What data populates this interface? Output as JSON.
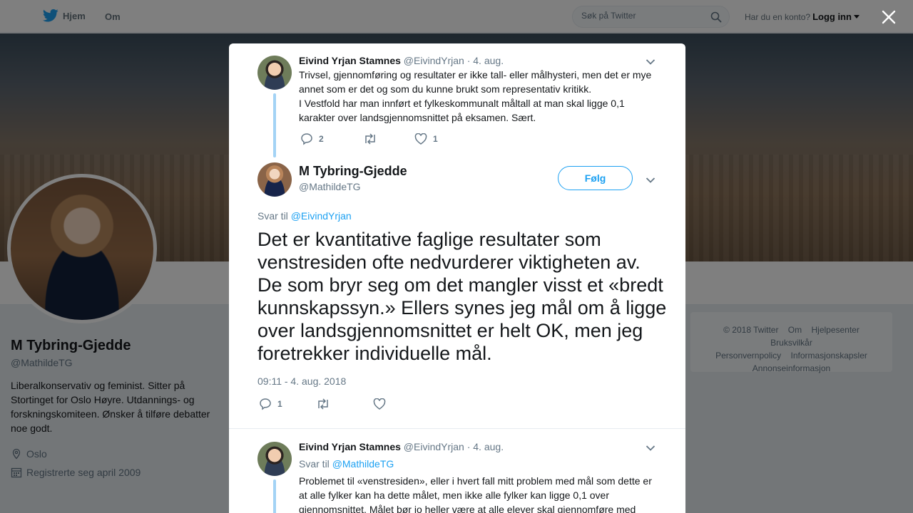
{
  "nav": {
    "home_label": "Hjem",
    "about_label": "Om",
    "search_placeholder": "Søk på Twitter",
    "account_prompt": "Har du en konto?",
    "login_label": "Logg inn"
  },
  "profile": {
    "name": "M Tybring-Gjedde",
    "handle": "@MathildeTG",
    "bio": "Liberalkonservativ og feminist. Sitter på Stortinget for Oslo Høyre. Utdannings- og forskningskomiteen. Ønsker å tilføre debatter noe godt.",
    "location": "Oslo",
    "joined": "Registrerte seg april 2009"
  },
  "footer": {
    "copyright": "© 2018 Twitter",
    "about": "Om",
    "help": "Hjelpesenter",
    "terms": "Bruksvilkår",
    "privacy": "Personvernpolicy",
    "cookies": "Informasjonskapsler",
    "ads": "Annonseinformasjon"
  },
  "modal": {
    "parent": {
      "name": "Eivind Yrjan Stamnes",
      "handle": "@EivindYrjan",
      "date": "· 4. aug.",
      "text_1": "Trivsel, gjennomføring og resultater er ikke tall- eller målhysteri, men det er mye annet som er det og som du kunne brukt som representativ kritikk.",
      "text_2": "I Vestfold har man innført et fylkeskommunalt måltall at man skal ligge 0,1 karakter over landsgjennomsnittet på eksamen. Sært.",
      "reply_count": "2",
      "like_count": "1"
    },
    "main": {
      "name": "M Tybring-Gjedde",
      "handle": "@MathildeTG",
      "follow_label": "Følg",
      "reply_prefix": "Svar til",
      "reply_to": "@EivindYrjan",
      "text": "Det er kvantitative faglige resultater som venstresiden ofte nedvurderer viktigheten av. De som bryr seg om det mangler visst et «bredt kunnskapssyn.» Ellers synes jeg mål om å ligge over landsgjennomsnittet er helt OK, men jeg foretrekker individuelle mål.",
      "timestamp": "09:11 - 4. aug. 2018",
      "reply_count": "1"
    },
    "reply": {
      "name": "Eivind Yrjan Stamnes",
      "handle": "@EivindYrjan",
      "date": "· 4. aug.",
      "reply_prefix": "Svar til",
      "reply_to": "@MathildeTG",
      "text": "Problemet til «venstresiden», eller i hvert fall mitt problem med mål som dette er at alle fylker kan ha dette målet, men ikke alle fylker kan ligge 0,1 over gjennomsnittet. Målet bør jo heller være at alle elever skal gjennomføre med"
    }
  },
  "icons": {
    "twitter_bird": "twitter-bird-icon",
    "search": "search-icon",
    "close": "close-icon",
    "reply": "reply-icon",
    "retweet": "retweet-icon",
    "like": "heart-icon",
    "location": "location-pin-icon",
    "calendar": "calendar-icon",
    "caret": "chevron-down-icon"
  },
  "colors": {
    "accent": "#1da1f2",
    "thread_line": "#a3d3f5",
    "text_primary": "#14171a",
    "text_secondary": "#657786"
  }
}
